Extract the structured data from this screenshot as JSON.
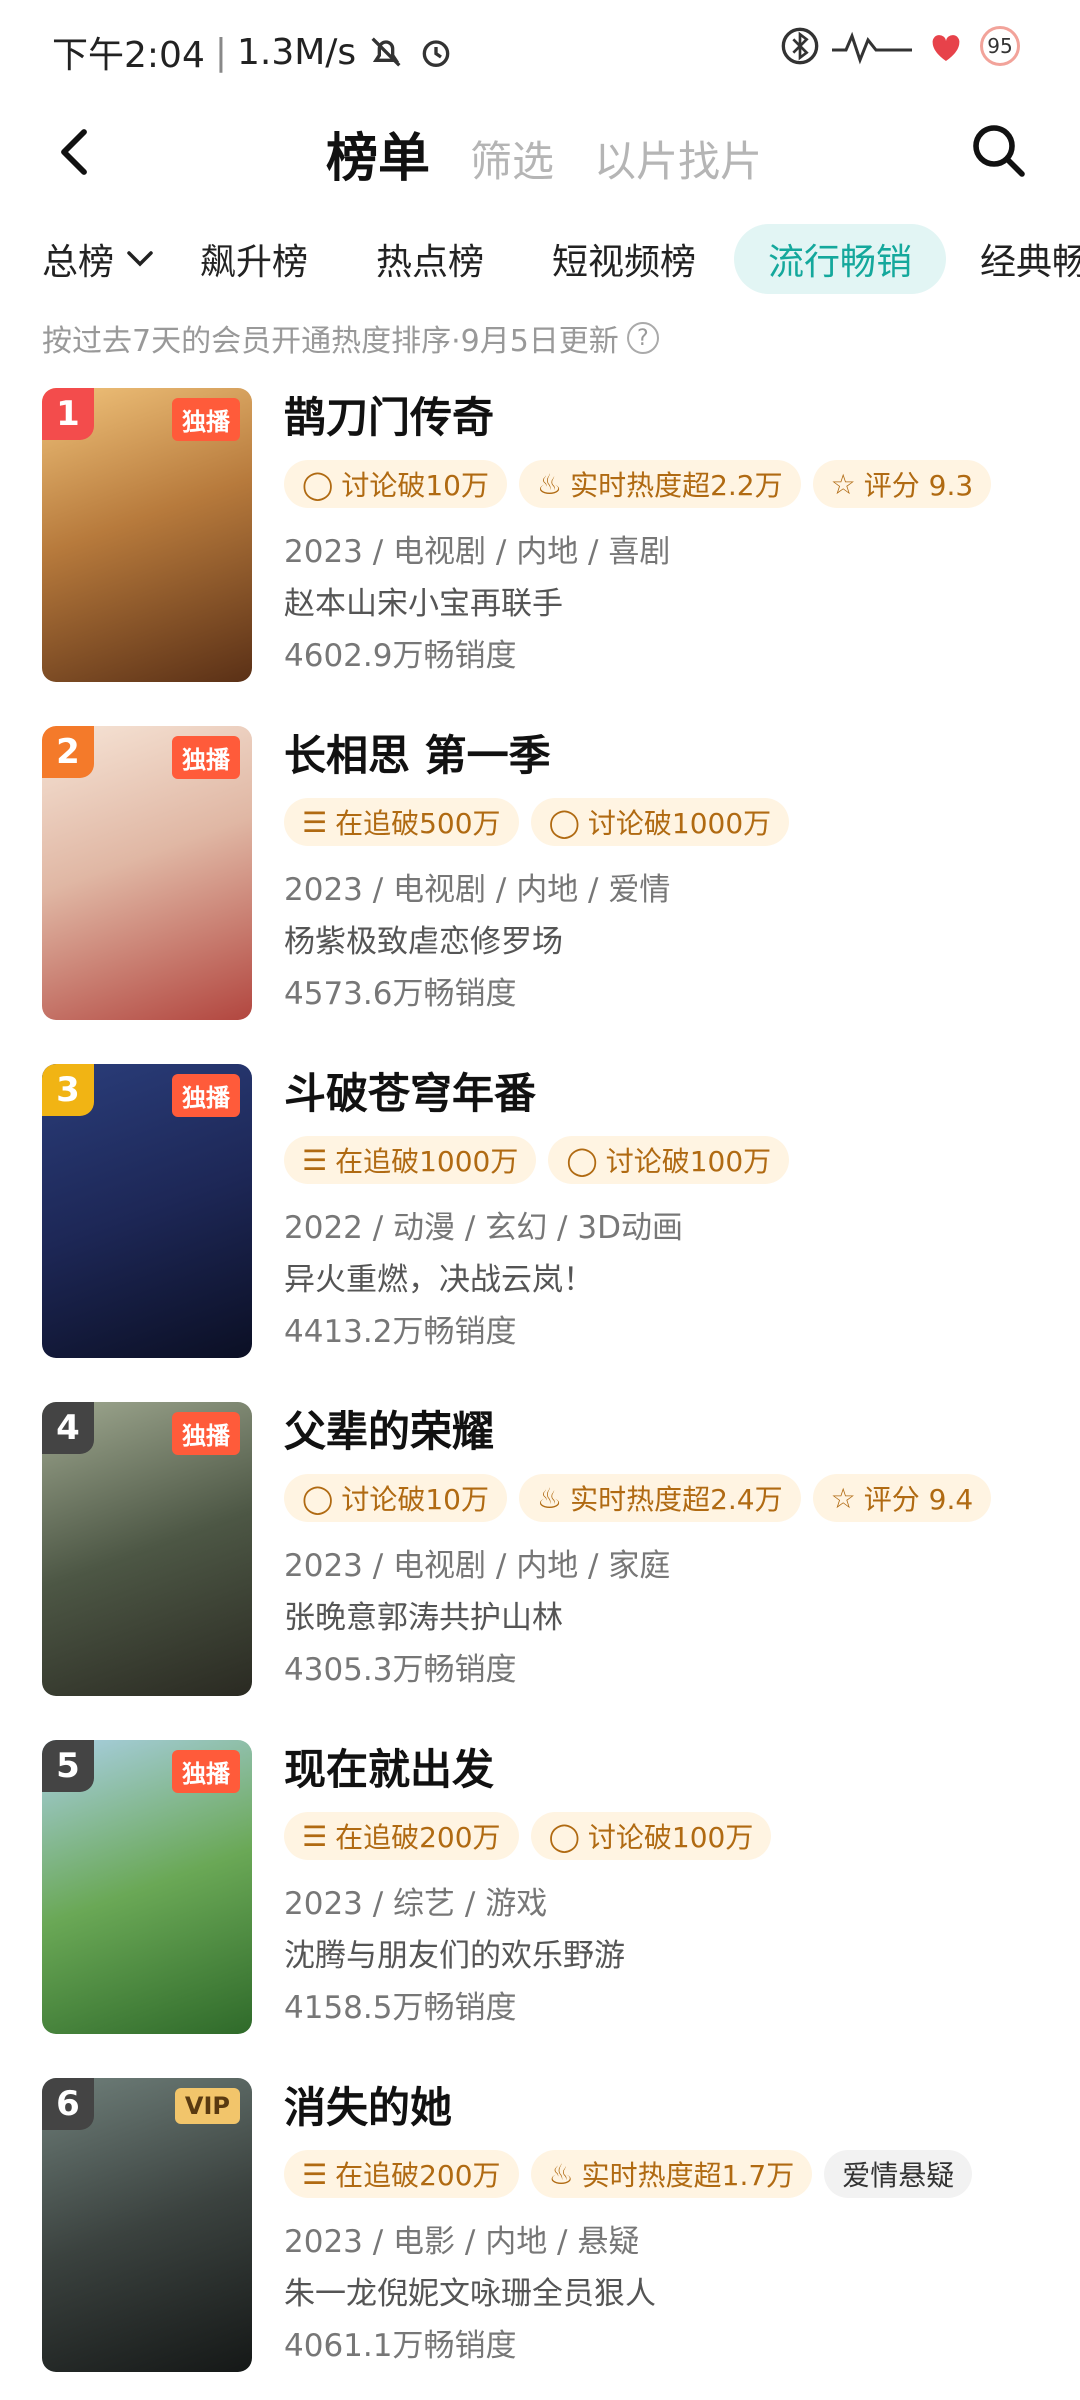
{
  "status_bar": {
    "time": "下午2:04",
    "speed": "1.3M/s",
    "battery": "95"
  },
  "nav": {
    "tabs": [
      {
        "label": "榜单",
        "active": true
      },
      {
        "label": "筛选",
        "active": false
      },
      {
        "label": "以片找片",
        "active": false
      }
    ]
  },
  "categories": {
    "all_label": "总榜",
    "items": [
      "飙升榜",
      "热点榜",
      "短视频榜",
      "流行畅销",
      "经典畅"
    ]
  },
  "hint": "按过去7天的会员开通热度排序·9月5日更新",
  "items": [
    {
      "rank": "1",
      "badge": "独播",
      "title": "鹊刀门传奇",
      "tags": [
        "讨论破10万",
        "实时热度超2.2万",
        "评分 9.3"
      ],
      "meta": "2023 / 电视剧 / 内地 / 喜剧",
      "desc": "赵本山宋小宝再联手",
      "heat": "4602.9万畅销度"
    },
    {
      "rank": "2",
      "badge": "独播",
      "title": "长相思 第一季",
      "tags": [
        "在追破500万",
        "讨论破1000万"
      ],
      "meta": "2023 / 电视剧 / 内地 / 爱情",
      "desc": "杨紫极致虐恋修罗场",
      "heat": "4573.6万畅销度"
    },
    {
      "rank": "3",
      "badge": "独播",
      "title": "斗破苍穹年番",
      "tags": [
        "在追破1000万",
        "讨论破100万"
      ],
      "meta": "2022 / 动漫 / 玄幻 / 3D动画",
      "desc": "异火重燃，决战云岚！",
      "heat": "4413.2万畅销度"
    },
    {
      "rank": "4",
      "badge": "独播",
      "title": "父辈的荣耀",
      "tags": [
        "讨论破10万",
        "实时热度超2.4万",
        "评分 9.4"
      ],
      "meta": "2023 / 电视剧 / 内地 / 家庭",
      "desc": "张晚意郭涛共护山林",
      "heat": "4305.3万畅销度"
    },
    {
      "rank": "5",
      "badge": "独播",
      "title": "现在就出发",
      "tags": [
        "在追破200万",
        "讨论破100万"
      ],
      "meta": "2023 / 综艺 / 游戏",
      "desc": "沈腾与朋友们的欢乐野游",
      "heat": "4158.5万畅销度"
    },
    {
      "rank": "6",
      "badge": "VIP",
      "title": "消失的她",
      "tags": [
        "在追破200万",
        "实时热度超1.7万",
        "爱情悬疑"
      ],
      "meta": "2023 / 电影 / 内地 / 悬疑",
      "desc": "朱一龙倪妮文咏珊全员狠人",
      "heat": "4061.1万畅销度"
    }
  ]
}
